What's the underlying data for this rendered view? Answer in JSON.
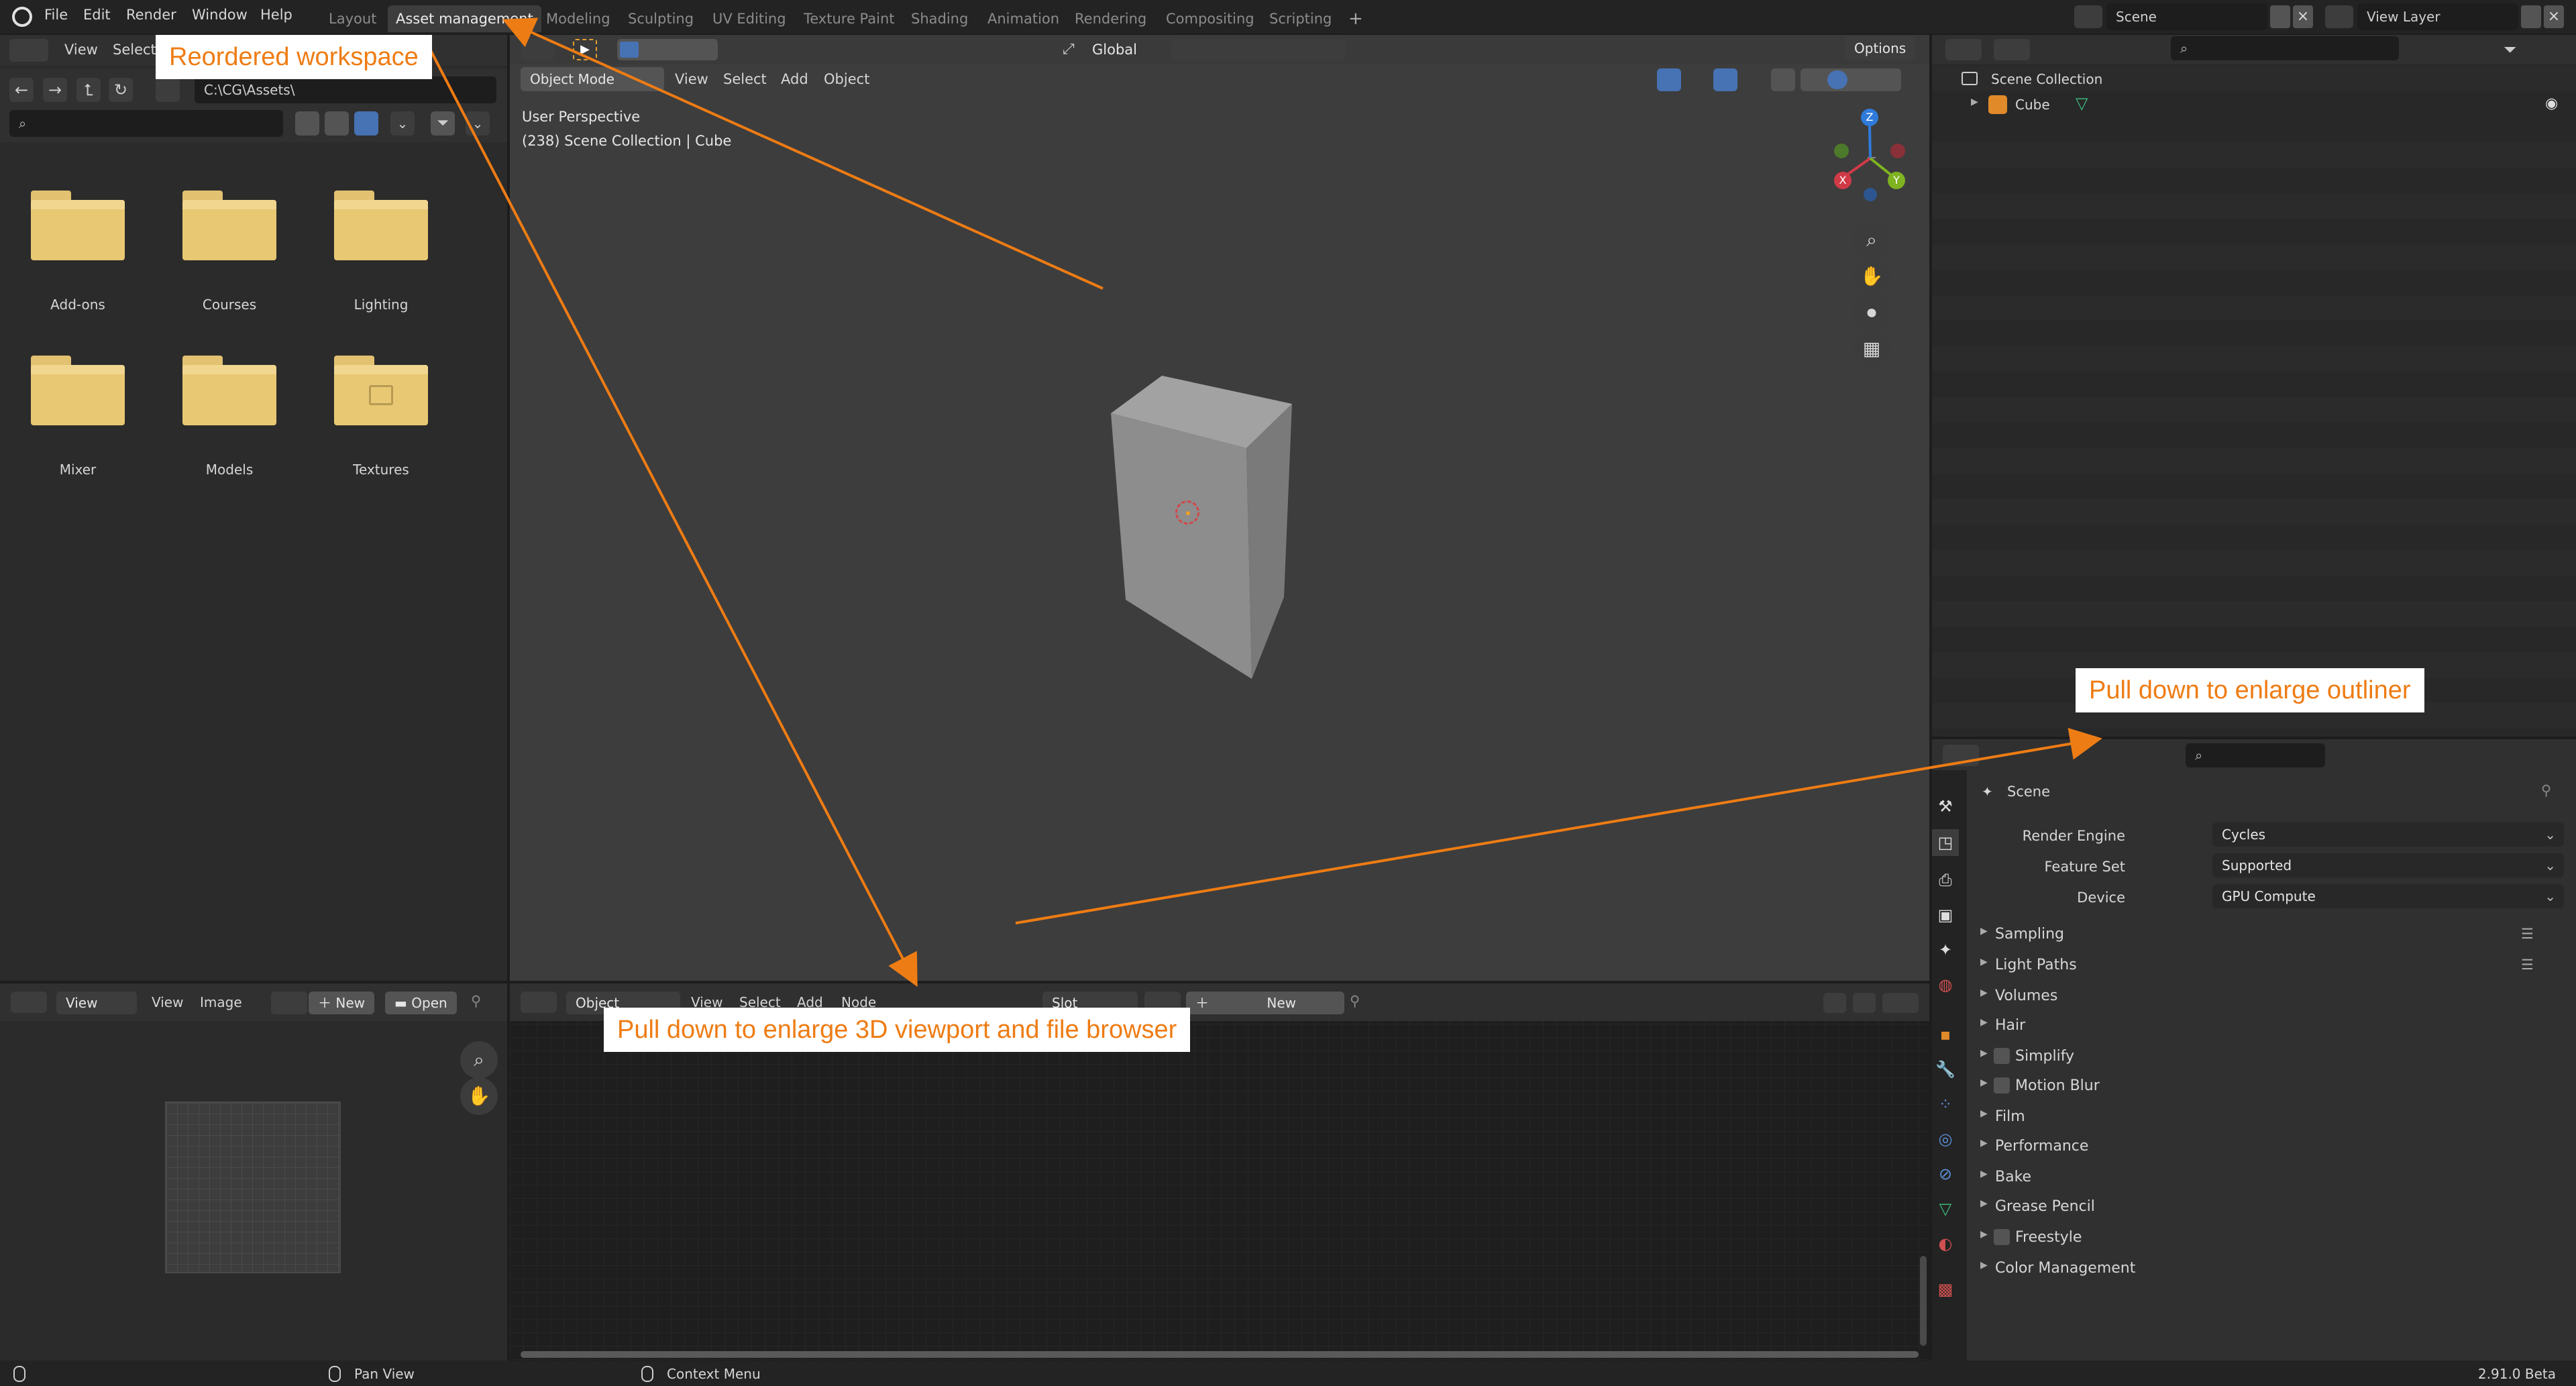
{
  "topbar": {
    "menus": [
      "File",
      "Edit",
      "Render",
      "Window",
      "Help"
    ],
    "tabs": [
      "Layout",
      "Asset management",
      "Modeling",
      "Sculpting",
      "UV Editing",
      "Texture Paint",
      "Shading",
      "Animation",
      "Rendering",
      "Compositing",
      "Scripting"
    ],
    "active_tab": "Asset management",
    "add_tab": "+",
    "scene": "Scene",
    "view_layer": "View Layer"
  },
  "file_browser": {
    "menus": [
      "View",
      "Select"
    ],
    "path": "C:\\CG\\Assets\\",
    "search_placeholder": "",
    "folders": [
      "Add-ons",
      "Courses",
      "Lighting",
      "Mixer",
      "Models",
      "Textures"
    ]
  },
  "viewport": {
    "mode": "Object Mode",
    "menus": [
      "View",
      "Select",
      "Add",
      "Object"
    ],
    "transform": "Global",
    "options": "Options",
    "info_line1": "User Perspective",
    "info_line2": "(238) Scene Collection | Cube",
    "gizmo": {
      "z": "Z",
      "x": "X",
      "y": "Y"
    }
  },
  "outliner": {
    "collection": "Scene Collection",
    "object": "Cube"
  },
  "properties": {
    "scene_label": "Scene",
    "render_engine_label": "Render Engine",
    "render_engine": "Cycles",
    "feature_set_label": "Feature Set",
    "feature_set": "Supported",
    "device_label": "Device",
    "device": "GPU Compute",
    "panels": [
      "Sampling",
      "Light Paths",
      "Volumes",
      "Hair",
      "Simplify",
      "Motion Blur",
      "Film",
      "Performance",
      "Bake",
      "Grease Pencil",
      "Freestyle",
      "Color Management"
    ]
  },
  "image_editor": {
    "menus": [
      "View",
      "View",
      "Image"
    ],
    "new": "New",
    "open": "Open"
  },
  "node_editor": {
    "object": "Object",
    "menus": [
      "View",
      "Select",
      "Add",
      "Node"
    ],
    "slot": "Slot",
    "new": "New"
  },
  "statusbar": {
    "pan": "Pan View",
    "context": "Context Menu",
    "version": "2.91.0 Beta"
  },
  "callouts": {
    "workspace": "Reordered workspace",
    "outliner": "Pull down to enlarge outliner",
    "viewport": "Pull down to enlarge 3D viewport and file browser"
  },
  "colors": {
    "accent": "#ee7c14",
    "folder": "#e8c873",
    "selected": "#4772b3"
  }
}
